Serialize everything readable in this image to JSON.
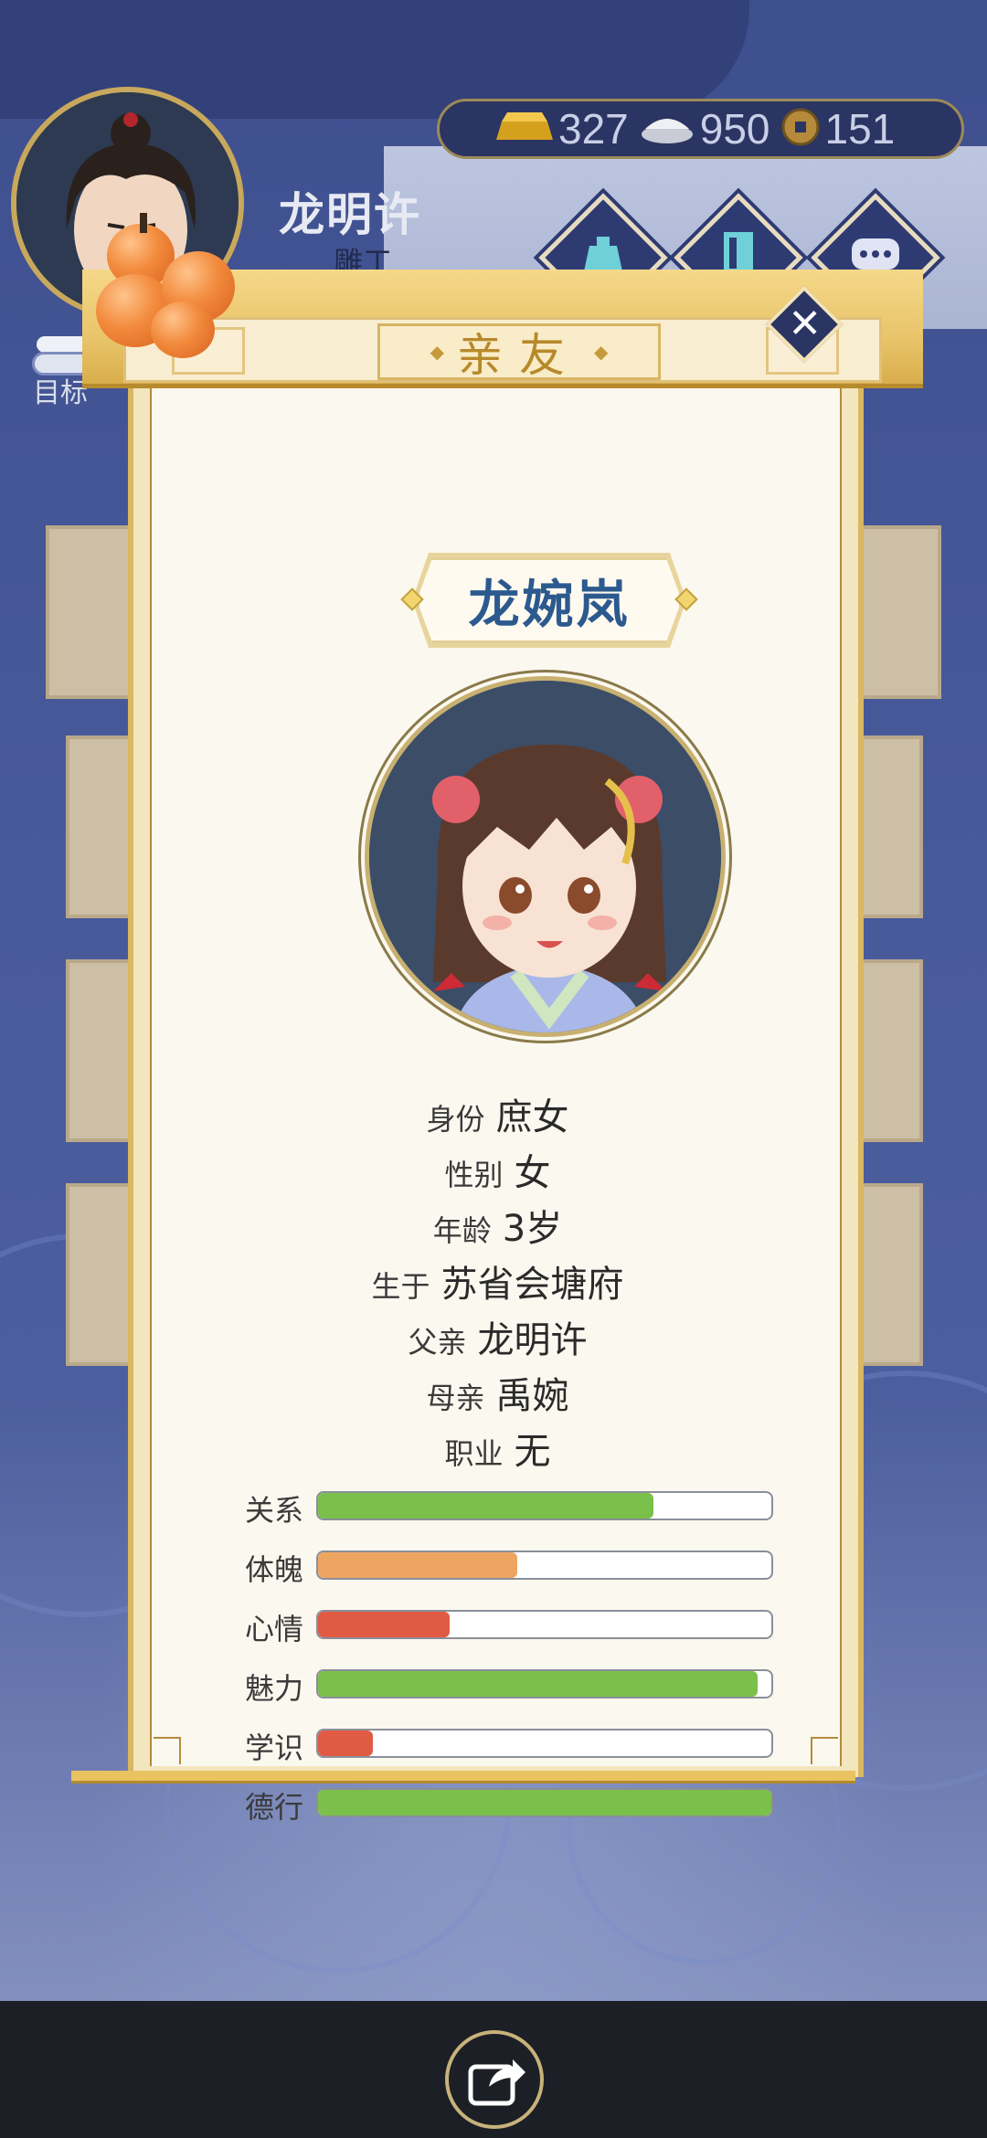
{
  "player": {
    "name": "龙明许",
    "job": "雕工",
    "target_label": "目标"
  },
  "currency": {
    "gold": "327",
    "silver": "950",
    "coin": "151"
  },
  "dialog": {
    "title": "亲友",
    "close_label": "✕",
    "character": {
      "name": "龙婉岚",
      "info": [
        {
          "label": "身份",
          "value": "庶女"
        },
        {
          "label": "性别",
          "value": "女"
        },
        {
          "label": "年龄",
          "value": "3岁"
        },
        {
          "label": "生于",
          "value": "苏省会塘府"
        },
        {
          "label": "父亲",
          "value": "龙明许"
        },
        {
          "label": "母亲",
          "value": "禹婉"
        },
        {
          "label": "职业",
          "value": "无"
        }
      ],
      "stats": [
        {
          "label": "关系",
          "level": 0.74,
          "color": "#7ac04a"
        },
        {
          "label": "体魄",
          "level": 0.44,
          "color": "#eea562"
        },
        {
          "label": "心情",
          "level": 0.29,
          "color": "#e05a44"
        },
        {
          "label": "魅力",
          "level": 0.97,
          "color": "#7ac04a"
        },
        {
          "label": "学识",
          "level": 0.12,
          "color": "#e05a44"
        },
        {
          "label": "德行",
          "level": 1.0,
          "color": "#7ac04a"
        }
      ]
    }
  },
  "icons": {
    "gold": "gold-ingot-icon",
    "silver": "silver-ingot-icon",
    "coin": "copper-coin-icon",
    "share": "share-icon"
  }
}
